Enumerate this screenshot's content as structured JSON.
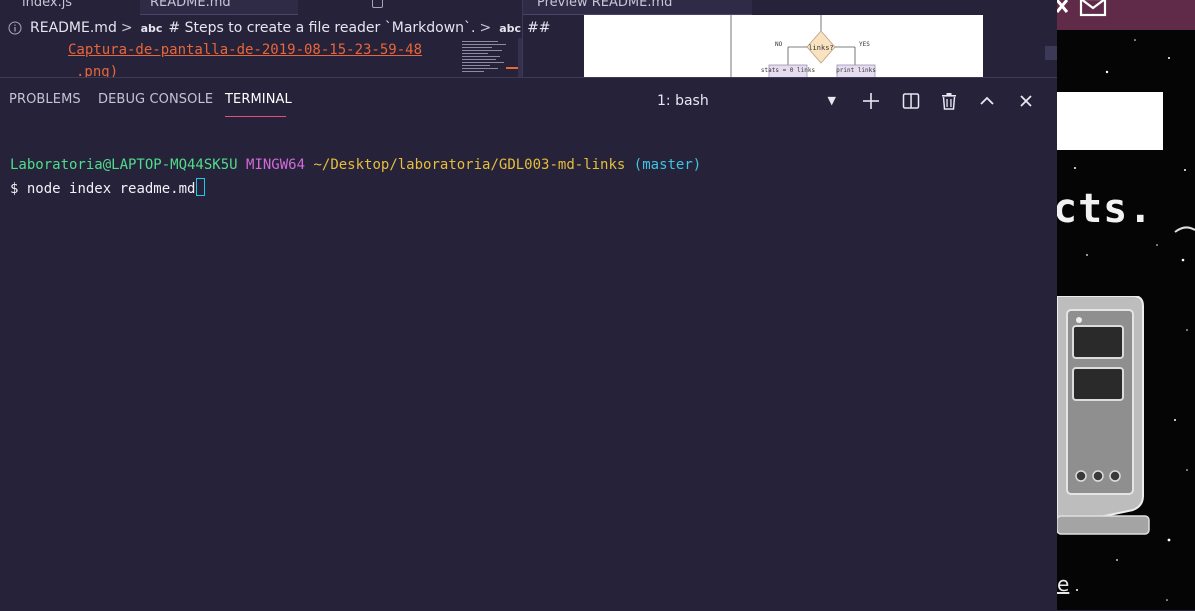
{
  "editor": {
    "tabs": [
      "index.js",
      "README.md",
      "Preview README.md"
    ],
    "breadcrumb": {
      "file": "README.md",
      "sep1": ">",
      "symbol_badge": "abc",
      "heading": "# Steps to create a file reader `Markdown`.",
      "sep2": ">",
      "symbol_badge_2": "abc",
      "heading_2": "##"
    },
    "link_text": "Captura-de-pantalla-de-2019-08-15-23-59-48",
    "link_text_2": ".png)",
    "preview_flowchart": {
      "no_label": "NO",
      "decision": "links?",
      "yes_label": "YES",
      "left_box": "stats = 0 links",
      "right_box": "print links"
    }
  },
  "panel": {
    "tabs": [
      "PROBLEMS",
      "DEBUG CONSOLE",
      "TERMINAL"
    ],
    "active_tab": "TERMINAL",
    "terminal_select": {
      "value": "1: bash",
      "caret": "▼"
    },
    "terminal": {
      "user": "Laboratoria@LAPTOP-MQ44SK5U",
      "env": "MINGW64",
      "path": "~/Desktop/laboratoria/GDL003-md-links",
      "branch": "(master)",
      "prompt_symbol": "$",
      "command": "node index readme.md"
    }
  },
  "background_window": {
    "heading_fragment": "cts.",
    "footer_fragment": "e"
  },
  "colors": {
    "panel_bg": "#26223a",
    "active_tab_underline": "#e0507a",
    "term_user": "#4fdd8c",
    "term_env": "#d16bd8",
    "term_path": "#e5be3b",
    "term_branch": "#3ec5e0",
    "link": "#e8663a",
    "cursor": "#21c7e8"
  },
  "icons": {
    "info": "info-icon",
    "new_terminal": "plus-icon",
    "split": "split-icon",
    "kill": "trash-icon",
    "maximize": "chevron-up-icon",
    "close": "close-icon"
  }
}
